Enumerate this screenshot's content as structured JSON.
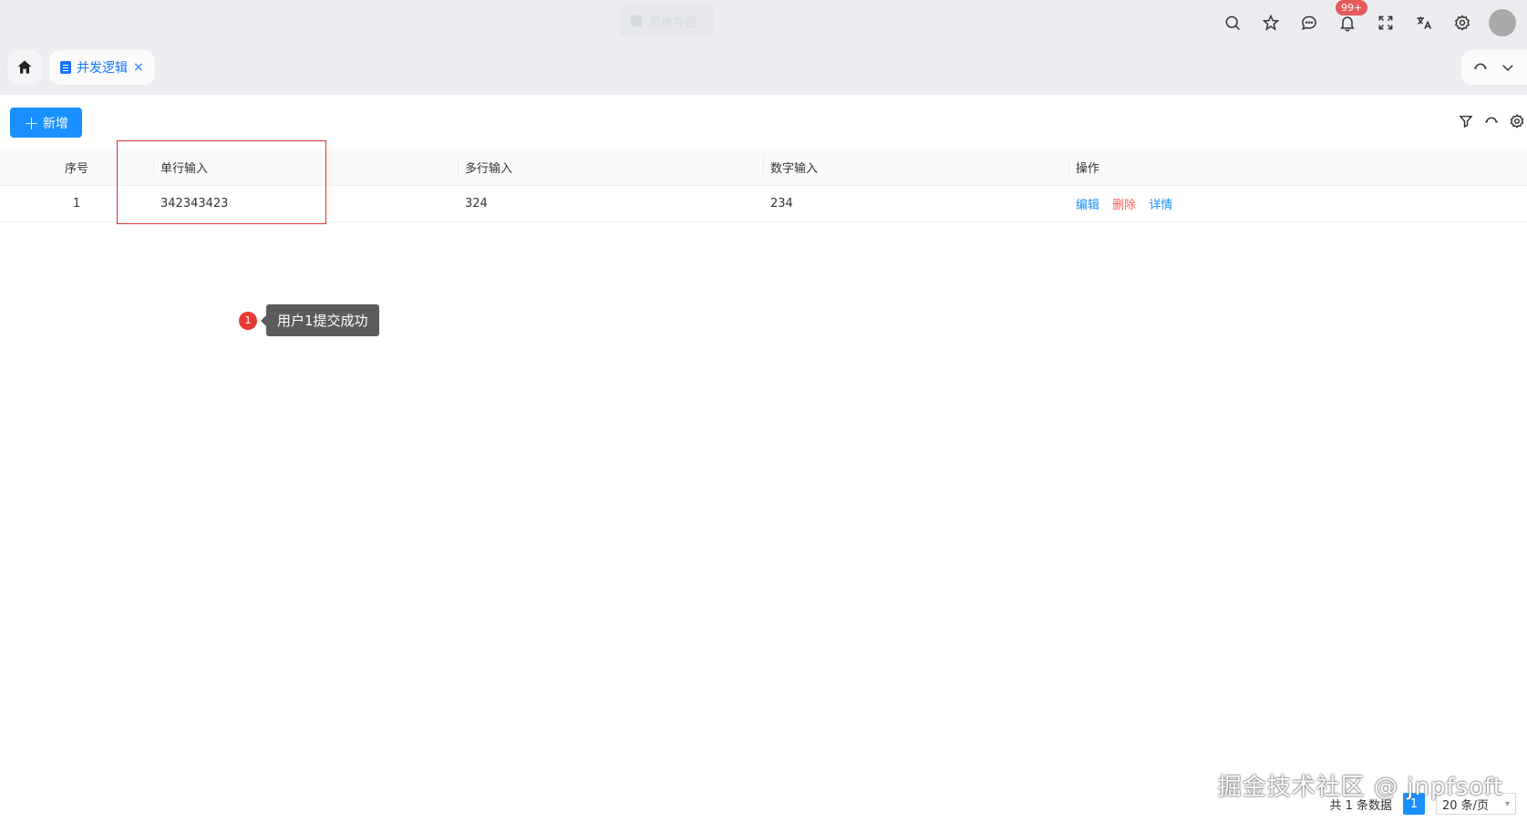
{
  "header": {
    "center_label": "思维导图",
    "notification_badge": "99+",
    "icons": [
      "search-icon",
      "star-icon",
      "message-icon",
      "bell-icon",
      "fullscreen-icon",
      "translate-icon",
      "gear-icon",
      "avatar"
    ]
  },
  "tabs": [
    {
      "label": "并发逻辑",
      "close": "×",
      "active": true
    }
  ],
  "toolbar": {
    "add_label": "新增",
    "add_plus": "+"
  },
  "table": {
    "columns": [
      "序号",
      "单行输入",
      "多行输入",
      "数字输入",
      "操作"
    ],
    "rows": [
      {
        "index": "1",
        "single": "342343423",
        "multi": "324",
        "number": "234",
        "actions": {
          "edit": "编辑",
          "delete": "删除",
          "detail": "详情"
        }
      }
    ]
  },
  "annotation": {
    "number": "1",
    "text": "用户1提交成功"
  },
  "pagination": {
    "total_text": "共 1 条数据",
    "current_page": "1",
    "page_size": "20 条/页"
  },
  "watermark": "掘金技术社区 @ jnpfsoft",
  "colors": {
    "primary": "#1890ff",
    "danger": "#ff5c5c",
    "highlight_border": "#e03030",
    "badge": "#e45a5a"
  }
}
